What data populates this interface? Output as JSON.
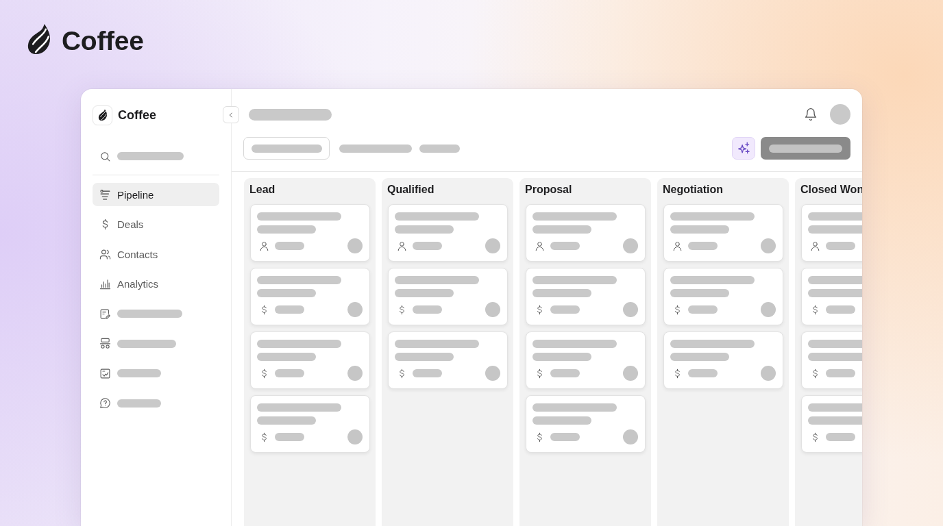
{
  "header": {
    "brand": "Coffee"
  },
  "app": {
    "sidebar": {
      "brand": "Coffee",
      "nav": [
        {
          "kind": "text",
          "label": "Pipeline",
          "selected": true
        },
        {
          "kind": "text",
          "label": "Deals",
          "selected": false
        },
        {
          "kind": "text",
          "label": "Contacts",
          "selected": false
        },
        {
          "kind": "text",
          "label": "Analytics",
          "selected": false
        },
        {
          "kind": "placeholder",
          "selected": false
        },
        {
          "kind": "placeholder",
          "selected": false
        },
        {
          "kind": "placeholder",
          "selected": false
        },
        {
          "kind": "placeholder",
          "selected": false
        }
      ]
    },
    "board": {
      "columns": [
        {
          "title": "Lead",
          "cards": [
            {
              "kind": "contact"
            },
            {
              "kind": "amount"
            },
            {
              "kind": "amount"
            },
            {
              "kind": "amount"
            }
          ]
        },
        {
          "title": "Qualified",
          "cards": [
            {
              "kind": "contact"
            },
            {
              "kind": "amount"
            },
            {
              "kind": "amount"
            }
          ]
        },
        {
          "title": "Proposal",
          "cards": [
            {
              "kind": "contact"
            },
            {
              "kind": "amount"
            },
            {
              "kind": "amount"
            },
            {
              "kind": "amount"
            }
          ]
        },
        {
          "title": "Negotiation",
          "cards": [
            {
              "kind": "contact"
            },
            {
              "kind": "amount"
            },
            {
              "kind": "amount"
            }
          ]
        },
        {
          "title": "Closed Won",
          "cards": [
            {
              "kind": "contact"
            },
            {
              "kind": "amount"
            },
            {
              "kind": "amount"
            },
            {
              "kind": "amount"
            }
          ]
        }
      ]
    }
  }
}
